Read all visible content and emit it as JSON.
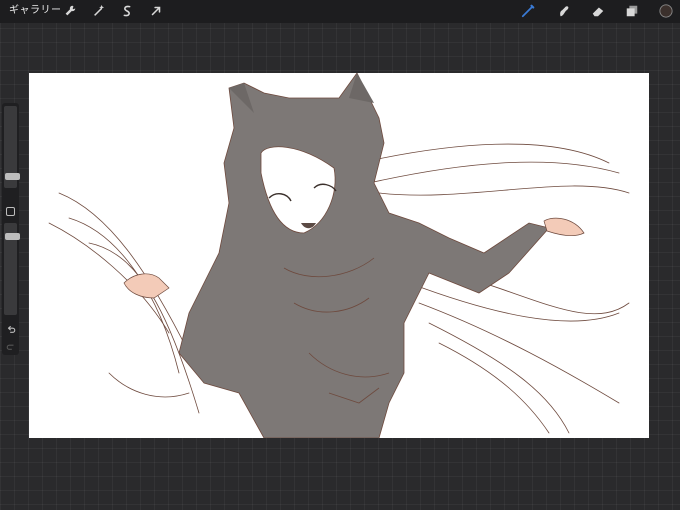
{
  "toolbar": {
    "gallery_label": "ギャラリー",
    "left_tools": [
      {
        "name": "wrench-icon",
        "label": "actions"
      },
      {
        "name": "magic-wand-icon",
        "label": "adjustments"
      },
      {
        "name": "selection-icon",
        "label": "selection"
      },
      {
        "name": "transform-arrow-icon",
        "label": "transform"
      }
    ],
    "right_tools": [
      {
        "name": "brush-icon",
        "active": true
      },
      {
        "name": "smudge-icon",
        "active": false
      },
      {
        "name": "eraser-icon",
        "active": false
      },
      {
        "name": "layers-icon",
        "active": false
      },
      {
        "name": "color-swatch",
        "active": false
      }
    ],
    "active_color": "#3a7bd5",
    "current_color": "#3b302c"
  },
  "sidebar": {
    "brush_size_level": 0.7,
    "opacity_level": 0.15
  },
  "canvas": {
    "background": "#ffffff",
    "fill_color": "#7d7876",
    "line_color": "#6e4a3e",
    "skin_color": "#f3cbb8"
  }
}
